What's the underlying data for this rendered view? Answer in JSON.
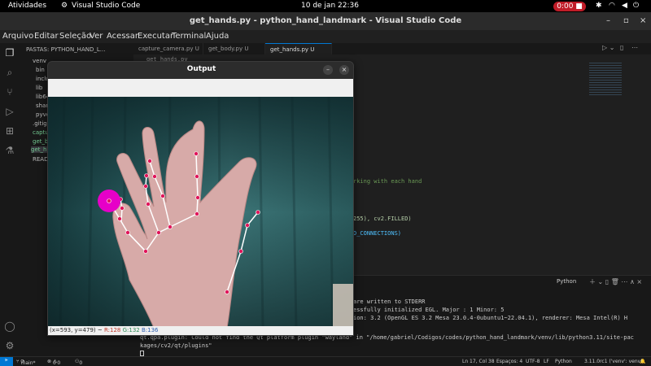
{
  "topbar": {
    "activities": "Atividades",
    "app_name": "Visual Studio Code",
    "clock": "10 de jan  22:36",
    "record_time": "0:00"
  },
  "window": {
    "title": "get_hands.py - python_hand_landmark - Visual Studio Code"
  },
  "menu": [
    "Arquivo",
    "Editar",
    "Seleção",
    "Ver",
    "Acessar",
    "Executar",
    "Terminal",
    "Ajuda"
  ],
  "sidebar": {
    "header": "PASTAS: PYTHON_HAND_L...",
    "items": [
      "venv",
      "bin",
      "inclu",
      "lib",
      "lib64",
      "share",
      "pyve",
      ".gitign",
      "captur",
      "get_bo",
      "get_h",
      "READM"
    ]
  },
  "tabs": [
    {
      "label": "capture_camera.py  U"
    },
    {
      "label": "get_body.py  U"
    },
    {
      "label": "get_hands.py  U"
    }
  ],
  "breadcrumb": "get_hands.py",
  "code_lines": [
    "rking with each hand",
    "255), cv2.FILLED)",
    "D_CONNECTIONS)"
  ],
  "panel": {
    "python_label": "Python",
    "lines": [
      "are written to STDERR",
      "essfully initialized EGL. Major : 1 Minor: 5",
      "ion: 3.2 (OpenGL ES 3.2 Mesa 23.0.4-0ubuntu1~22.04.1), renderer: Mesa Intel(R) H",
      "qt.qpa.plugin: Could not find the Qt platform plugin \"wayland\" in \"/home/gabriel/Codigos/codes/python_hand_landmark/venv/lib/python3.11/site-pac",
      "kages/cv2/qt/plugins\""
    ]
  },
  "statusbar": {
    "branch": "main*",
    "errors": "0",
    "warnings": "0",
    "ports": "0",
    "position": "Ln 17, Col 38",
    "spaces": "Espaços: 4",
    "encoding": "UTF-8",
    "eol": "LF",
    "language": "Python",
    "interpreter": "3.11.0rc1 ('venv': venv)"
  },
  "output_window": {
    "title": "Output",
    "coords": "(x=593, y=479) ~",
    "r": "R:128",
    "g": "G:132",
    "b": "B:136"
  }
}
